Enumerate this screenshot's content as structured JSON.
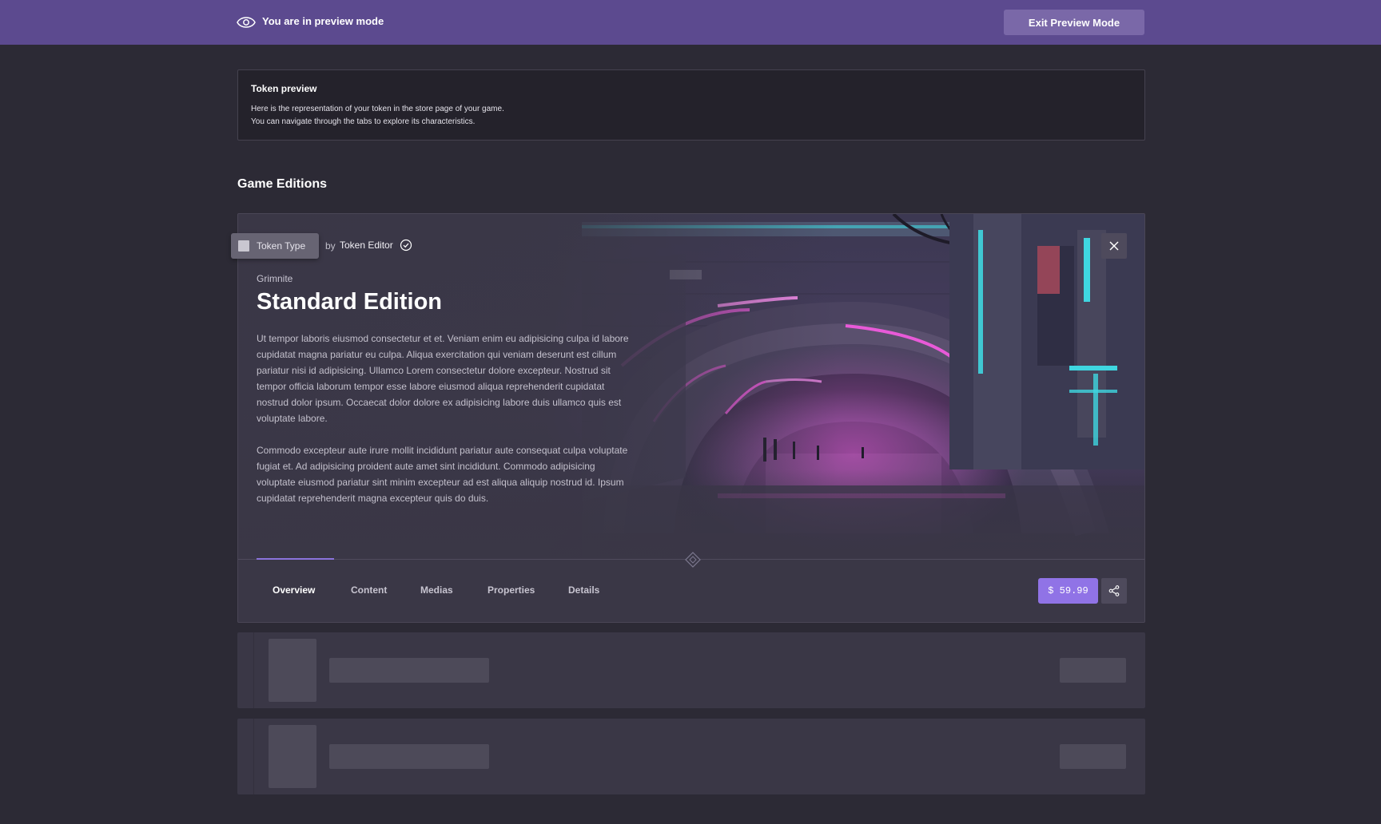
{
  "preview_bar": {
    "message": "You are in preview mode",
    "exit_label": "Exit Preview Mode",
    "icon": "eye-icon"
  },
  "info_card": {
    "title": "Token preview",
    "line1": "Here is the representation of your token in the store page of your game.",
    "line2": "You can navigate through the tabs to explore its characteristics."
  },
  "section": {
    "title": "Game Editions"
  },
  "edition": {
    "token_type": "Token Type",
    "by": "by",
    "author": "Token Editor",
    "game": "Grimnite",
    "title": "Standard Edition",
    "description_1": "Ut tempor laboris eiusmod consectetur et et. Veniam enim eu adipisicing culpa id labore cupidatat magna pariatur eu culpa. Aliqua exercitation qui veniam deserunt est cillum pariatur nisi id adipisicing. Ullamco Lorem consectetur dolore excepteur. Nostrud sit tempor officia laborum tempor esse labore eiusmod aliqua reprehenderit cupidatat nostrud dolor ipsum. Occaecat dolor dolore ex adipisicing labore duis ullamco quis est voluptate labore.",
    "description_2": "Commodo excepteur aute irure mollit incididunt pariatur aute consequat culpa voluptate fugiat et. Ad adipisicing proident aute amet sint incididunt. Commodo adipisicing voluptate eiusmod pariatur sint minim excepteur ad est aliqua aliquip nostrud id. Ipsum cupidatat reprehenderit magna excepteur quis do duis.",
    "tabs": [
      {
        "label": "Overview",
        "active": true
      },
      {
        "label": "Content",
        "active": false
      },
      {
        "label": "Medias",
        "active": false
      },
      {
        "label": "Properties",
        "active": false
      },
      {
        "label": "Details",
        "active": false
      }
    ],
    "price": "$ 59.99"
  },
  "colors": {
    "accent": "#9073e6",
    "preview_bar": "#5c4a8f",
    "background": "#2c2a35",
    "card": "#3a3746",
    "neon_pink": "#e85ad8",
    "neon_cyan": "#3fd6e0"
  }
}
